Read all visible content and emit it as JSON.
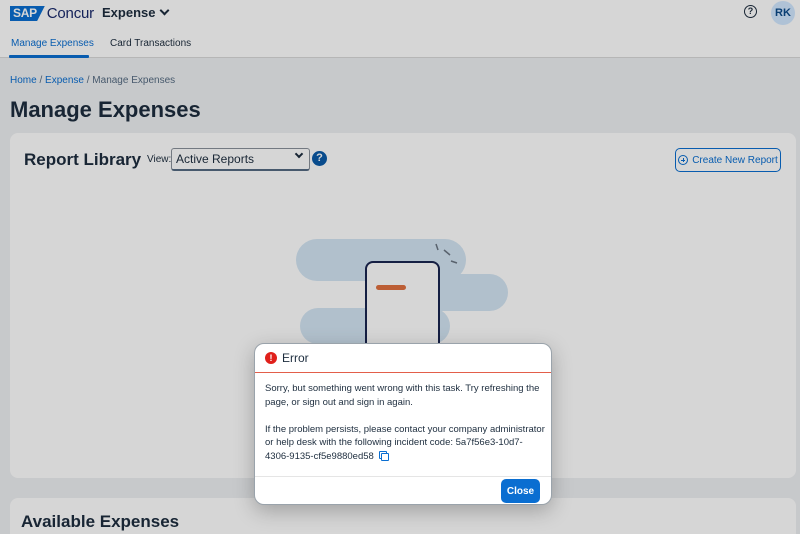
{
  "header": {
    "logo_sap": "SAP",
    "logo_product": "Concur",
    "app_switcher": "Expense",
    "help_glyph": "?",
    "avatar_initials": "RK"
  },
  "tabs": [
    {
      "label": "Manage Expenses",
      "active": true
    },
    {
      "label": "Card Transactions",
      "active": false
    }
  ],
  "breadcrumb": {
    "home": "Home",
    "expense": "Expense",
    "current": "Manage Expenses",
    "sep": "/"
  },
  "page_title": "Manage Expenses",
  "report_library": {
    "title": "Report Library",
    "view_label": "View:",
    "view_value": "Active Reports",
    "help_glyph": "?",
    "create_label": "Create New Report"
  },
  "available_expenses": {
    "title": "Available Expenses"
  },
  "error_dialog": {
    "icon_glyph": "!",
    "title": "Error",
    "message1": "Sorry, but something went wrong with this task. Try refreshing the page, or sign out and sign in again.",
    "message2": "If the problem persists, please contact your company administrator or help desk with the following incident code: 5a7f56e3-10d7-4306-9135-cf5e9880ed58",
    "close_label": "Close"
  },
  "icons": {
    "app_chevron": "chevron-down-icon",
    "help": "help-circle-icon",
    "select_chevron": "chevron-down-icon",
    "create": "plus-circle-icon",
    "error": "error-icon",
    "copy": "copy-icon"
  },
  "colors": {
    "brand": "#0a6ed1",
    "error": "#e0201b",
    "title": "#1d2d3e",
    "page_bg": "#eef0f2"
  }
}
